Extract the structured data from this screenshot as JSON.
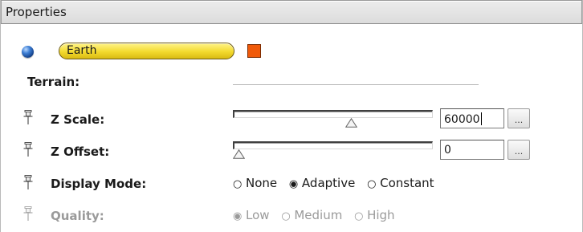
{
  "panel": {
    "title": "Properties"
  },
  "planet": {
    "name": "Earth",
    "icon": "globe-icon",
    "color": "#f05a0a"
  },
  "terrain": {
    "section_label": "Terrain:",
    "z_scale": {
      "label": "Z Scale:",
      "value": "60000",
      "slider_fraction": 0.6,
      "browse_label": "..."
    },
    "z_offset": {
      "label": "Z Offset:",
      "value": "0",
      "slider_fraction": 0.0,
      "browse_label": "..."
    },
    "display_mode": {
      "label": "Display Mode:",
      "options": [
        "None",
        "Adaptive",
        "Constant"
      ],
      "selected": "Adaptive"
    },
    "quality": {
      "label": "Quality:",
      "options": [
        "Low",
        "Medium",
        "High"
      ],
      "selected": "Low",
      "disabled": true
    }
  },
  "colors": {
    "pill_fill": "#f3da2e",
    "swatch": "#f05a0a",
    "disabled_text": "#9a9a9a"
  }
}
